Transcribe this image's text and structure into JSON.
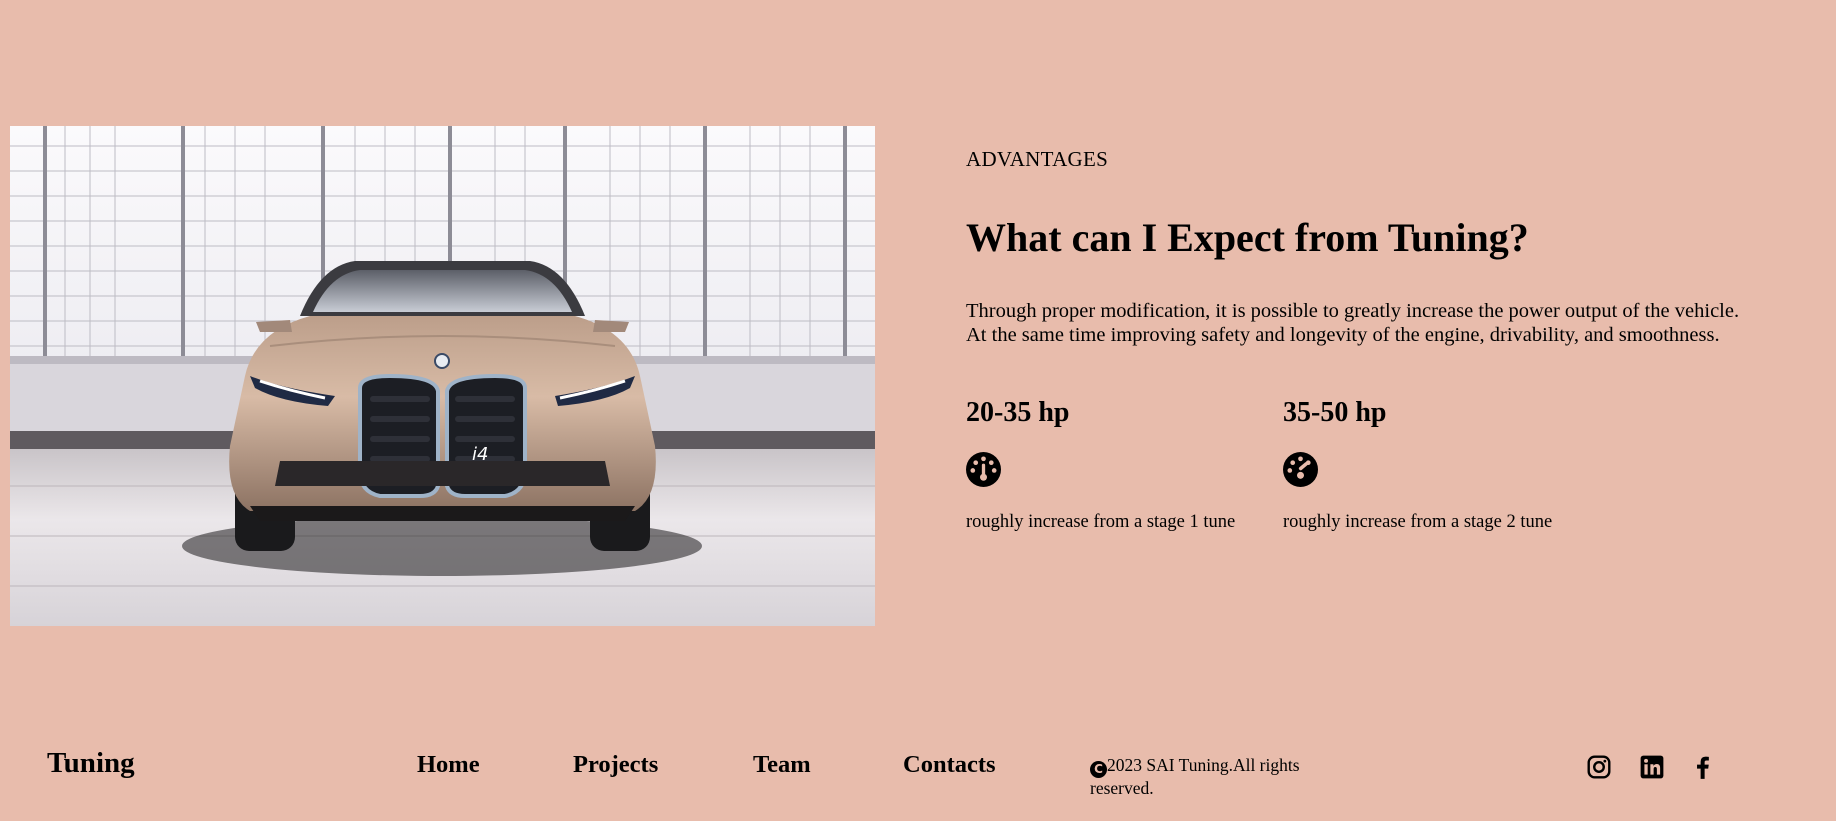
{
  "advantages": {
    "eyebrow": "ADVANTAGES",
    "heading": "What can I Expect from Tuning?",
    "description_line1": "Through proper modification, it is possible to greatly increase the power output of the vehicle.",
    "description_line2": "At the same time improving safety and longevity of the engine, drivability, and smoothness.",
    "stats": [
      {
        "value": "20-35 hp",
        "icon": "speedometer-icon",
        "caption": "roughly increase from a stage 1 tune"
      },
      {
        "value": "35-50 hp",
        "icon": "speedometer-icon",
        "caption": "roughly increase from a stage 2 tune"
      }
    ]
  },
  "hero_image": {
    "subject": "car-photo",
    "plate_text": "i4"
  },
  "footer": {
    "brand": "Tuning",
    "nav": [
      {
        "label": "Home"
      },
      {
        "label": "Projects"
      },
      {
        "label": "Team"
      },
      {
        "label": "Contacts"
      }
    ],
    "copyright_symbol": "C",
    "copyright_text": "2023 SAI Tuning.All rights reserved.",
    "social": [
      {
        "icon": "instagram-icon"
      },
      {
        "icon": "linkedin-icon"
      },
      {
        "icon": "facebook-icon"
      }
    ]
  },
  "colors": {
    "background": "#e8bcac",
    "text": "#000000"
  }
}
